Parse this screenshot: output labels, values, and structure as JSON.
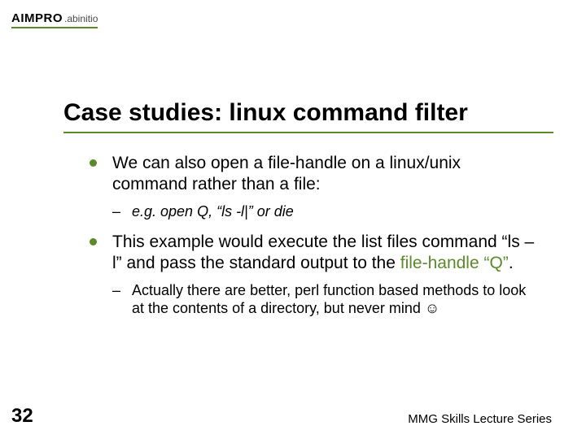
{
  "logo": {
    "brand": "AIMPRO",
    "sub": ".abinitio"
  },
  "title": "Case studies: linux command filter",
  "bullets": [
    {
      "text": "We can also open a file-handle on a linux/unix command rather than a file:",
      "sub": [
        {
          "italic": true,
          "text": "e.g. open Q, “ls -l|” or die"
        }
      ]
    },
    {
      "runs": [
        {
          "text": "This example would execute the list files command “ls –l” and pass the standard output to the "
        },
        {
          "text": "file-handle “Q”",
          "accent": true
        },
        {
          "text": "."
        }
      ],
      "sub": [
        {
          "italic": false,
          "text": "Actually there are better, perl function based methods to look at the contents of a directory, but never mind ☺"
        }
      ]
    }
  ],
  "page_number": "32",
  "footer": "MMG Skills Lecture Series"
}
